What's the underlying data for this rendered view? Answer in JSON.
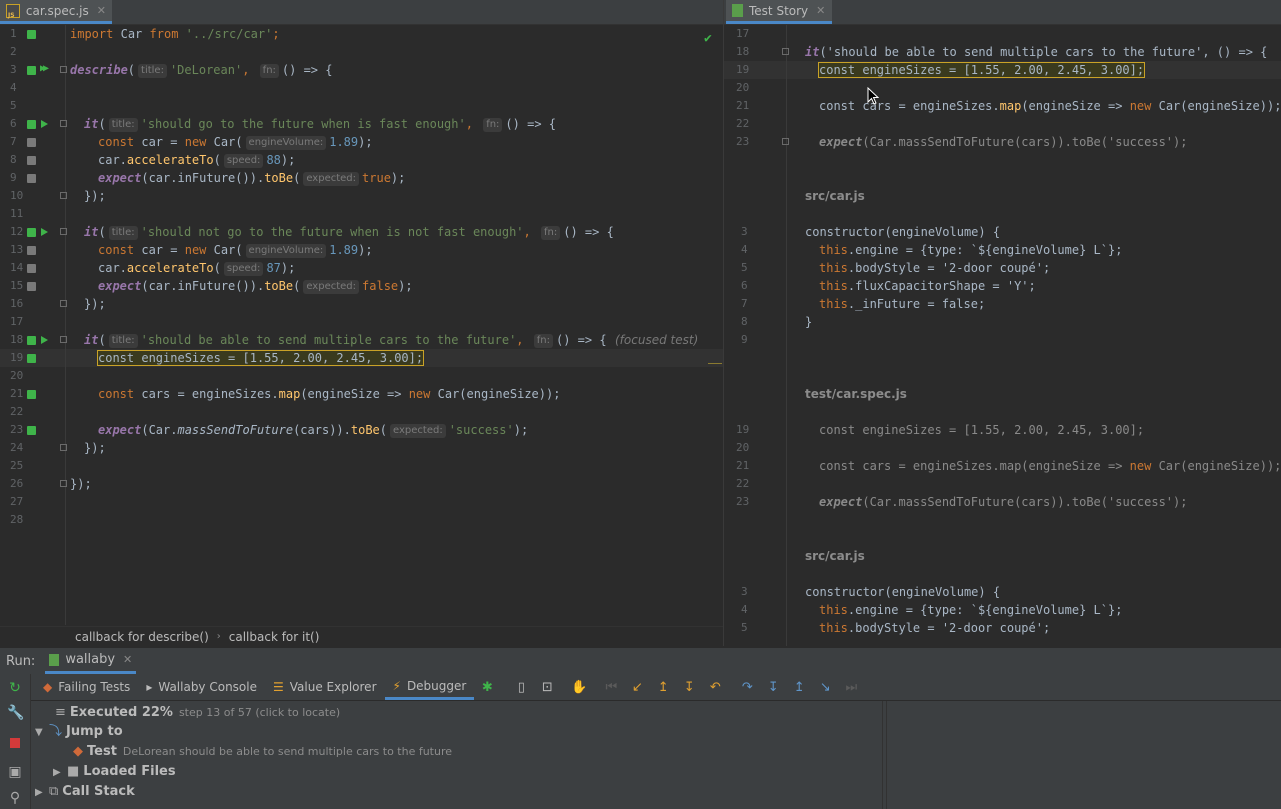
{
  "tabs_left": {
    "title": "car.spec.js",
    "close": "✕"
  },
  "tabs_right": {
    "title": "Test Story",
    "close": "✕"
  },
  "left_editor": {
    "lines": [
      {
        "n": "1"
      },
      {
        "n": "2"
      },
      {
        "n": "3"
      },
      {
        "n": "4"
      },
      {
        "n": "5"
      },
      {
        "n": "6"
      },
      {
        "n": "7"
      },
      {
        "n": "8"
      },
      {
        "n": "9"
      },
      {
        "n": "10"
      },
      {
        "n": "11"
      },
      {
        "n": "12"
      },
      {
        "n": "13"
      },
      {
        "n": "14"
      },
      {
        "n": "15"
      },
      {
        "n": "16"
      },
      {
        "n": "17"
      },
      {
        "n": "18"
      },
      {
        "n": "19"
      },
      {
        "n": "20"
      },
      {
        "n": "21"
      },
      {
        "n": "22"
      },
      {
        "n": "23"
      },
      {
        "n": "24"
      },
      {
        "n": "25"
      },
      {
        "n": "26"
      },
      {
        "n": "27"
      },
      {
        "n": "28"
      }
    ],
    "t": {
      "import_kw": "import",
      "car_cls": "Car",
      "from_kw": "from",
      "src_path": "'../src/car'",
      "semi": ";",
      "describe": "describe",
      "paren_open": "(",
      "title_hint": "title:",
      "desc_title": "'DeLorean'",
      "comma": ",",
      "fn_hint": "fn:",
      "arrow": "() => {",
      "it": "it",
      "test1_title": "'should go to the future when is fast enough'",
      "const_kw": "const",
      "car_var": "car =",
      "new_kw": "new",
      "car_call": "Car(",
      "engine_hint": "engineVolume:",
      "ev": "1.89",
      "close_semi": ");",
      "car_dot": "car.",
      "accelerate": "accelerateTo",
      "speed_hint": "speed:",
      "speed88": "88",
      "speed87": "87",
      "expect": "expect",
      "infuture_expr": "(car.inFuture()).",
      "tobe": "toBe",
      "expected_hint": "expected:",
      "true_kw": "true",
      "false_kw": "false",
      "close_block": "});",
      "test2_title": "'should not go to the future when is not fast enough'",
      "test3_title": "'should be able to send multiple cars to the future'",
      "focused": "(focused test)",
      "sizes_line": "const engineSizes = [1.55, 2.00, 2.45, 3.00];",
      "cars_var": "cars = engineSizes.",
      "map": "map",
      "map_arg": "(engineSize => ",
      "car_es": "Car(engineSize));",
      "car_static": "(Car.",
      "mass": "massSendToFuture",
      "mass_args": "(cars)).",
      "success": "'success'",
      "final_close": "});"
    }
  },
  "breadcrumbs": [
    "callback for describe()",
    "callback for it()"
  ],
  "story": {
    "nums_a": [
      "17",
      "18",
      "19",
      "20",
      "21",
      "22",
      "23"
    ],
    "t": {
      "it_call": "it",
      "t3_args": "('should be able to send multiple cars to the future', () => {",
      "sizes_line": "const engineSizes = [1.55, 2.00, 2.45, 3.00];",
      "cars_pre": "const cars = engineSizes.",
      "map": "map",
      "map_mid": "(engineSize => ",
      "new_kw": "new",
      "map_end": " Car(engineSize));",
      "expect": "expect",
      "mass_line": "(Car.massSendToFuture(cars)).toBe('success');",
      "file1": "src/car.js",
      "ctor": "constructor(engineVolume) {",
      "this": "this",
      "engine_line": ".engine = {type: `${engineVolume} L`};",
      "body_line": ".bodyStyle = '2-door coupé';",
      "flux_line": ".fluxCapacitorShape = 'Y';",
      "infuture_line": "._inFuture = false;",
      "ctor_close": "}",
      "file2": "test/car.spec.js",
      "dim_cars_pre": "const cars = engineSizes.map(engineSize => ",
      "dim_map_end": " Car(engineSize));"
    },
    "nums_ctor": [
      "3",
      "4",
      "5",
      "6",
      "7",
      "8",
      "9"
    ],
    "nums_b": [
      "19",
      "20",
      "21",
      "22",
      "23"
    ],
    "nums_ctor2": [
      "3",
      "4",
      "5"
    ]
  },
  "run": {
    "label": "Run:",
    "tab": "wallaby",
    "tab_close": "✕",
    "tabs": [
      "Failing Tests",
      "Wallaby Console",
      "Value Explorer",
      "Debugger"
    ],
    "executed_label": "Executed 22%",
    "executed_sub": "step 13 of 57 (click to locate)",
    "jump_to": "Jump to",
    "test_label": "Test",
    "test_sub": "DeLorean should be able to send multiple cars to the future",
    "loaded_files": "Loaded Files",
    "call_stack": "Call Stack"
  },
  "icons": {
    "check": "check-icon",
    "mouse": "cursor-icon"
  }
}
